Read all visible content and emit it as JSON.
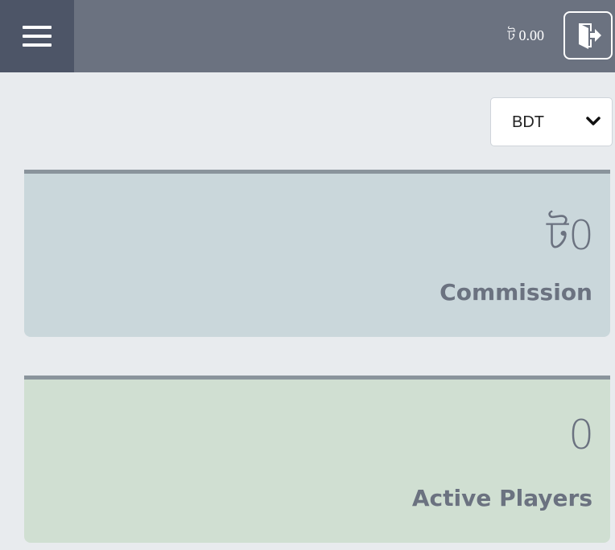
{
  "header": {
    "menu_icon": "hamburger-menu-icon",
    "balance": "ট 0.00",
    "logout_icon": "logout-door-icon"
  },
  "currency": {
    "selected": "BDT"
  },
  "stats": {
    "commission": {
      "value": "ট0",
      "label": "Commission"
    },
    "active_players": {
      "value": "0",
      "label": "Active Players"
    }
  },
  "colors": {
    "topbar": "#6b7280",
    "menu_button": "#4d5567",
    "commission_card": "#cad7db",
    "players_card": "#d0dfd2",
    "card_border": "#8a949c"
  }
}
